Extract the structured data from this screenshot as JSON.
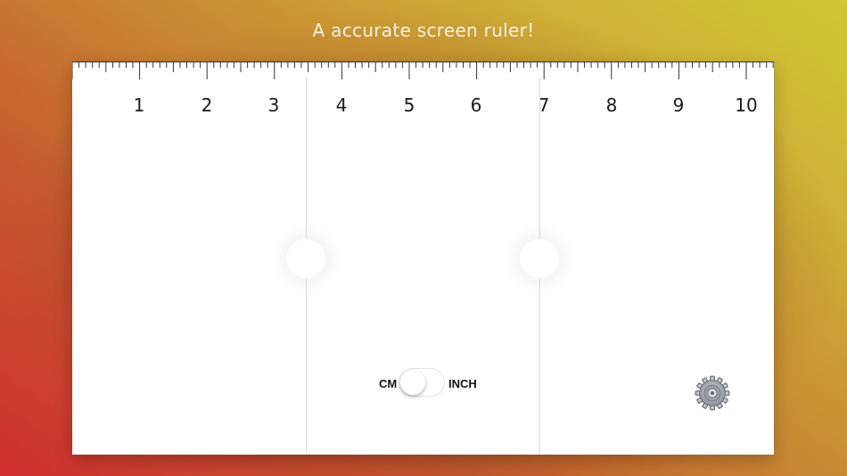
{
  "header": {
    "title": "A accurate screen ruler!"
  },
  "ruler": {
    "numbers": [
      "1",
      "2",
      "3",
      "4",
      "5",
      "6",
      "7",
      "8",
      "9",
      "10"
    ],
    "unit_switch": {
      "left_label": "CM",
      "right_label": "INCH",
      "selected": "CM"
    }
  },
  "icons": {
    "settings": "gear-icon"
  }
}
